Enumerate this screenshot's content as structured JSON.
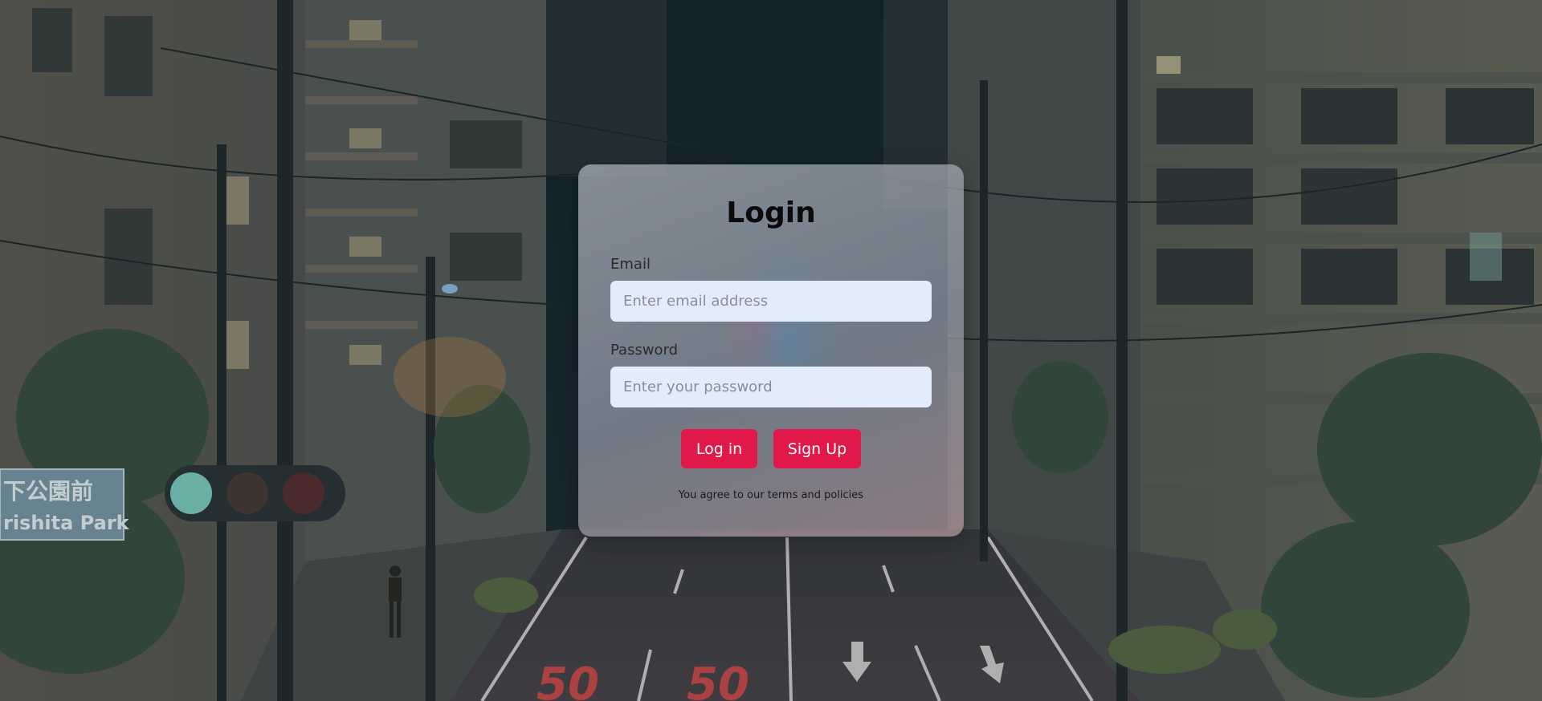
{
  "login": {
    "title": "Login",
    "email_label": "Email",
    "email_placeholder": "Enter email address",
    "password_label": "Password",
    "password_placeholder": "Enter your password",
    "login_button": "Log in",
    "signup_button": "Sign Up",
    "terms": "You agree to our terms and policies"
  },
  "background": {
    "sign_line1": "下公園前",
    "sign_line2": "rishita Park",
    "road_marking_left": "50",
    "road_marking_right": "50"
  },
  "colors": {
    "accent": "#e0194a",
    "input_bg": "#e3ecfb",
    "title": "#0b0b0b"
  }
}
